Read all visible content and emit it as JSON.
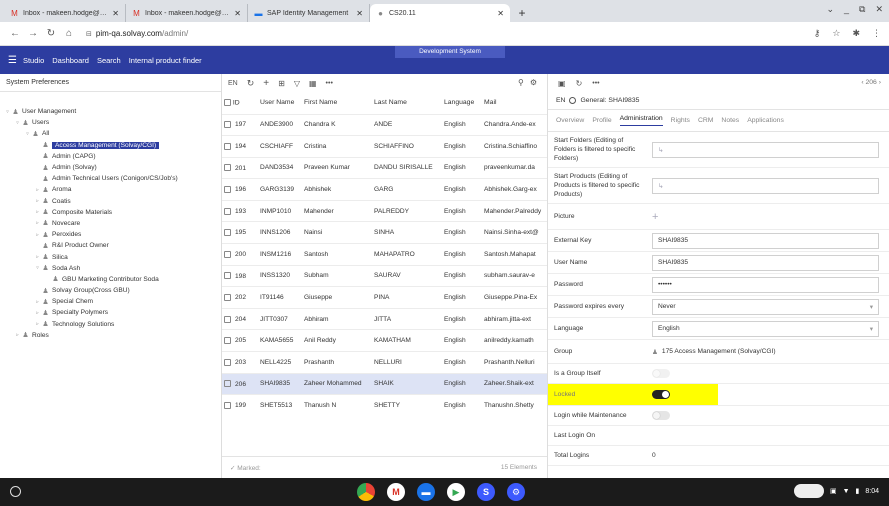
{
  "browser": {
    "tabs": [
      {
        "icon": "gmail-icon",
        "title": "Inbox - makeen.hodge@solvay.c",
        "active": false
      },
      {
        "icon": "gmail-icon",
        "title": "Inbox - makeen.hodge@solvay.c",
        "active": false
      },
      {
        "icon": "sap-icon",
        "title": "SAP Identity Management",
        "active": false
      },
      {
        "icon": "page-icon",
        "title": "CS20.11",
        "active": true
      }
    ],
    "url_host": "pim-qa.solvay.com",
    "url_path": "/admin/"
  },
  "app": {
    "nav": [
      "Studio",
      "Dashboard",
      "Search",
      "Internal product finder"
    ],
    "env_badge": "Development System"
  },
  "left": {
    "title": "System Preferences",
    "tree": [
      {
        "label": "User Management",
        "level": 0,
        "caret": "▿",
        "selected": false
      },
      {
        "label": "Users",
        "level": 1,
        "caret": "▿",
        "selected": false
      },
      {
        "label": "All",
        "level": 2,
        "caret": "▿",
        "selected": false
      },
      {
        "label": "Access Management (Solvay/CGI)",
        "level": 3,
        "caret": "",
        "selected": true
      },
      {
        "label": "Admin (CAPG)",
        "level": 3,
        "caret": "",
        "selected": false
      },
      {
        "label": "Admin (Solvay)",
        "level": 3,
        "caret": "",
        "selected": false
      },
      {
        "label": "Admin Technical Users (Conigon/CS/Job's)",
        "level": 3,
        "caret": "",
        "selected": false
      },
      {
        "label": "Aroma",
        "level": 3,
        "caret": "▹",
        "selected": false
      },
      {
        "label": "Coatis",
        "level": 3,
        "caret": "▹",
        "selected": false
      },
      {
        "label": "Composite Materials",
        "level": 3,
        "caret": "▹",
        "selected": false
      },
      {
        "label": "Novecare",
        "level": 3,
        "caret": "▹",
        "selected": false
      },
      {
        "label": "Peroxides",
        "level": 3,
        "caret": "▹",
        "selected": false
      },
      {
        "label": "R&I Product Owner",
        "level": 3,
        "caret": "",
        "selected": false
      },
      {
        "label": "Silica",
        "level": 3,
        "caret": "▹",
        "selected": false
      },
      {
        "label": "Soda Ash",
        "level": 3,
        "caret": "▿",
        "selected": false
      },
      {
        "label": "GBU Marketing Contributor Soda",
        "level": 4,
        "caret": "",
        "selected": false
      },
      {
        "label": "Solvay Group(Cross GBU)",
        "level": 3,
        "caret": "",
        "selected": false
      },
      {
        "label": "Special Chem",
        "level": 3,
        "caret": "▹",
        "selected": false
      },
      {
        "label": "Specialty Polymers",
        "level": 3,
        "caret": "▹",
        "selected": false
      },
      {
        "label": "Technology Solutions",
        "level": 3,
        "caret": "▹",
        "selected": false
      },
      {
        "label": "Roles",
        "level": 1,
        "caret": "▹",
        "selected": false
      }
    ]
  },
  "mid": {
    "lang": "EN",
    "columns": [
      "ID",
      "User Name",
      "First Name",
      "Last Name",
      "Language",
      "Mail"
    ],
    "rows": [
      {
        "id": "197",
        "user": "ANDE3900",
        "first": "Chandra K",
        "last": "ANDE",
        "lang": "English",
        "mail": "Chandra.Ande-ex",
        "sel": false
      },
      {
        "id": "194",
        "user": "CSCHIAFF",
        "first": "Cristina",
        "last": "SCHIAFFINO",
        "lang": "English",
        "mail": "Cristina.Schiaffino",
        "sel": false
      },
      {
        "id": "201",
        "user": "DAND3534",
        "first": "Praveen Kumar",
        "last": "DANDU SIRISALLE",
        "lang": "English",
        "mail": "praveenkumar.da",
        "sel": false
      },
      {
        "id": "196",
        "user": "GARG3139",
        "first": "Abhishek",
        "last": "GARG",
        "lang": "English",
        "mail": "Abhishek.Garg-ex",
        "sel": false
      },
      {
        "id": "193",
        "user": "INMP1010",
        "first": "Mahender",
        "last": "PALREDDY",
        "lang": "English",
        "mail": "Mahender.Palreddy",
        "sel": false
      },
      {
        "id": "195",
        "user": "INNS1206",
        "first": "Nainsi",
        "last": "SINHA",
        "lang": "English",
        "mail": "Nainsi.Sinha-ext@",
        "sel": false
      },
      {
        "id": "200",
        "user": "INSM1216",
        "first": "Santosh",
        "last": "MAHAPATRO",
        "lang": "English",
        "mail": "Santosh.Mahapat",
        "sel": false
      },
      {
        "id": "198",
        "user": "INSS1320",
        "first": "Subham",
        "last": "SAURAV",
        "lang": "English",
        "mail": "subham.saurav-e",
        "sel": false
      },
      {
        "id": "202",
        "user": "IT91146",
        "first": "Giuseppe",
        "last": "PINA",
        "lang": "English",
        "mail": "Giuseppe.Pina-Ex",
        "sel": false
      },
      {
        "id": "204",
        "user": "JITT0307",
        "first": "Abhiram",
        "last": "JITTA",
        "lang": "English",
        "mail": "abhiram.jitta-ext",
        "sel": false
      },
      {
        "id": "205",
        "user": "KAMA5655",
        "first": "Anil Reddy",
        "last": "KAMATHAM",
        "lang": "English",
        "mail": "anilreddy.kamath",
        "sel": false
      },
      {
        "id": "203",
        "user": "NELL4225",
        "first": "Prashanth",
        "last": "NELLURI",
        "lang": "English",
        "mail": "Prashanth.Nelluri",
        "sel": false
      },
      {
        "id": "206",
        "user": "SHAI9835",
        "first": "Zaheer Mohammed",
        "last": "SHAIK",
        "lang": "English",
        "mail": "Zaheer.Shaik-ext",
        "sel": true
      },
      {
        "id": "199",
        "user": "SHET5513",
        "first": "Thanush N",
        "last": "SHETTY",
        "lang": "English",
        "mail": "Thanushn.Shetty",
        "sel": false
      }
    ],
    "footer_marked": "✓ Marked:",
    "footer_count": "15 Elements"
  },
  "right": {
    "count": "‹ 206 ›",
    "lang": "EN",
    "general": "General: SHAI9835",
    "tabs": [
      "Overview",
      "Profile",
      "Administration",
      "Rights",
      "CRM",
      "Notes",
      "Applications"
    ],
    "active_tab": "Administration",
    "fields": {
      "start_folders_label": "Start Folders (Editing of Folders is filtered to specific Folders)",
      "start_products_label": "Start Products (Editing of Products is filtered to specific Products)",
      "picture_label": "Picture",
      "external_key_label": "External Key",
      "external_key_value": "SHAI9835",
      "user_name_label": "User Name",
      "user_name_value": "SHAI9835",
      "password_label": "Password",
      "password_value": "••••••",
      "pw_expires_label": "Password expires every",
      "pw_expires_value": "Never",
      "language_label": "Language",
      "language_value": "English",
      "group_label": "Group",
      "group_value": "175  Access Management (Solvay/CGI)",
      "is_group_label": "Is a Group Itself",
      "locked_label": "Locked",
      "login_maint_label": "Login while Maintenance",
      "last_login_label": "Last Login On",
      "total_logins_label": "Total Logins",
      "total_logins_value": "0"
    },
    "toggles": {
      "is_group": false,
      "locked": true,
      "login_maint": false
    }
  },
  "taskbar": {
    "time": "8:04"
  }
}
